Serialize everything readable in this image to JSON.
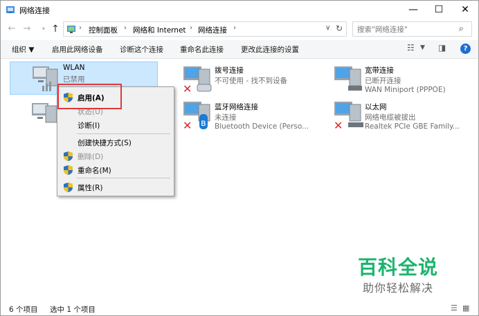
{
  "window": {
    "title": "网络连接",
    "controls": {
      "minimize": "—",
      "maximize": "☐",
      "close": "✕"
    }
  },
  "address_bar": {
    "breadcrumbs": [
      "控制面板",
      "网络和 Internet",
      "网络连接"
    ],
    "search_placeholder": "搜索\"网络连接\""
  },
  "command_bar": {
    "organize": "组织 ▼",
    "enable_device": "启用此网络设备",
    "diagnose": "诊断这个连接",
    "rename": "重命名此连接",
    "change_settings": "更改此连接的设置"
  },
  "connections": [
    {
      "name": "WLAN",
      "status": "已禁用",
      "device": "",
      "selected": true
    },
    {
      "name": "拨号连接",
      "status": "不可使用 - 找不到设备",
      "device": ""
    },
    {
      "name": "宽带连接",
      "status": "已断开连接",
      "device": "WAN Miniport (PPPOE)"
    },
    {
      "name": "蓝牙网络连接",
      "status": "未连接",
      "device": "Bluetooth Device (Perso..."
    },
    {
      "name": "以太网",
      "status": "网络电缆被拔出",
      "device": "Realtek PCIe GBE Family..."
    }
  ],
  "context_menu": {
    "items": [
      {
        "label": "启用(A)",
        "shield": true,
        "bold": true,
        "disabled": false
      },
      {
        "label": "状态(U)",
        "shield": false,
        "disabled": true
      },
      {
        "label": "诊断(I)",
        "shield": false,
        "disabled": false
      },
      {
        "label": "创建快捷方式(S)",
        "shield": false,
        "disabled": false
      },
      {
        "label": "删除(D)",
        "shield": true,
        "disabled": true
      },
      {
        "label": "重命名(M)",
        "shield": true,
        "disabled": false
      },
      {
        "label": "属性(R)",
        "shield": true,
        "disabled": false
      }
    ]
  },
  "status_bar": {
    "item_count": "6 个项目",
    "selected_count": "选中 1 个项目"
  },
  "watermark": {
    "title": "百科全说",
    "subtitle": "助你轻松解决"
  },
  "colors": {
    "selection_bg": "#cce8ff",
    "highlight_red": "#e0373c",
    "watermark_green": "#1cb36e",
    "help_blue": "#1c6fd1"
  }
}
